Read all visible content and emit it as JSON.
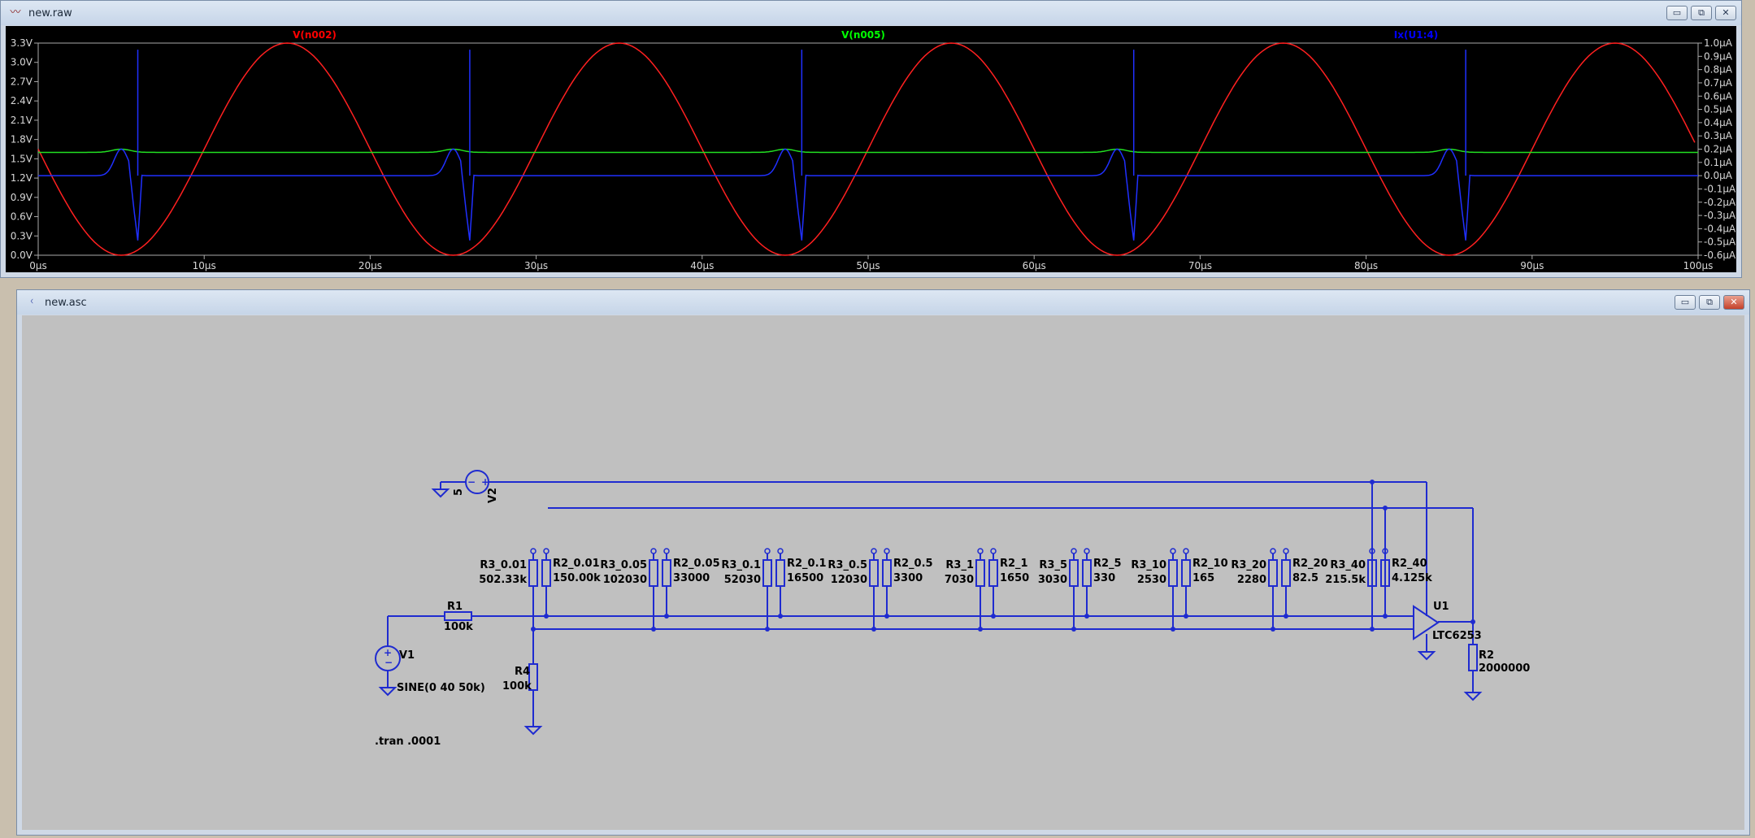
{
  "waveform_window": {
    "title": "new.raw",
    "minimize_label": "▭",
    "restore_label": "⧉",
    "close_label": "✕",
    "traces": [
      {
        "label": "V(n002)",
        "color": "#ff0000"
      },
      {
        "label": "V(n005)",
        "color": "#00ff00"
      },
      {
        "label": "Ix(U1:4)",
        "color": "#0000ff"
      }
    ],
    "left_ticks": [
      "3.3V",
      "3.0V",
      "2.7V",
      "2.4V",
      "2.1V",
      "1.8V",
      "1.5V",
      "1.2V",
      "0.9V",
      "0.6V",
      "0.3V",
      "0.0V"
    ],
    "right_ticks": [
      "1.0µA",
      "0.9µA",
      "0.8µA",
      "0.7µA",
      "0.6µA",
      "0.5µA",
      "0.4µA",
      "0.3µA",
      "0.2µA",
      "0.1µA",
      "0.0µA",
      "-0.1µA",
      "-0.2µA",
      "-0.3µA",
      "-0.4µA",
      "-0.5µA",
      "-0.6µA"
    ],
    "x_ticks": [
      "0µs",
      "10µs",
      "20µs",
      "30µs",
      "40µs",
      "50µs",
      "60µs",
      "70µs",
      "80µs",
      "90µs",
      "100µs"
    ]
  },
  "chart_data": {
    "type": "line",
    "xlabel": "",
    "x_unit": "µs",
    "xlim": [
      0,
      100
    ],
    "ylim_left": [
      0.0,
      3.3
    ],
    "ylim_right": [
      -0.6,
      1.0
    ],
    "grid": false,
    "legend_placement": "top",
    "series": [
      {
        "name": "V(n002)",
        "axis": "left",
        "shape": "sine",
        "period_us": 20,
        "min": 0.0,
        "max": 3.3,
        "peaks_us": [
          15,
          35,
          55,
          75,
          95
        ],
        "troughs_us": [
          5,
          25,
          45,
          65,
          85
        ],
        "values_at_x0": 1.6
      },
      {
        "name": "V(n005)",
        "axis": "left",
        "baseline": 1.6,
        "bump_peak": 1.65,
        "bump_times_us": [
          5,
          25,
          45,
          65,
          85
        ]
      },
      {
        "name": "Ix(U1:4)",
        "axis": "right",
        "baseline": 0.0,
        "spike_up_times_us": [
          6,
          26,
          46,
          66,
          86
        ],
        "spike_up": 0.95,
        "spike_down_times_us": [
          6,
          26,
          46,
          66,
          86
        ],
        "spike_down": -0.5,
        "bump_times_us": [
          5,
          25,
          45,
          65,
          85
        ],
        "bump_peak": 0.2
      }
    ]
  },
  "schematic_window": {
    "title": "new.asc",
    "minimize_label": "▭",
    "restore_label": "⧉",
    "close_label": "✕",
    "directive": ".tran .0001",
    "V1": {
      "name": "V1",
      "value": "SINE(0 40 50k)"
    },
    "V2": {
      "name": "V2",
      "value": "5"
    },
    "R1": {
      "name": "R1",
      "value": "100k"
    },
    "R4": {
      "name": "R4",
      "value": "100k"
    },
    "R2": {
      "name": "R2",
      "value": "2000000"
    },
    "U1": {
      "name": "U1",
      "value": "LTC6253"
    },
    "pairs": [
      {
        "r3": "R3_0.01",
        "r3v": "502.33k",
        "r2": "R2_0.01",
        "r2v": "150.00k"
      },
      {
        "r3": "R3_0.05",
        "r3v": "102030",
        "r2": "R2_0.05",
        "r2v": "33000"
      },
      {
        "r3": "R3_0.1",
        "r3v": "52030",
        "r2": "R2_0.1",
        "r2v": "16500"
      },
      {
        "r3": "R3_0.5",
        "r3v": "12030",
        "r2": "R2_0.5",
        "r2v": "3300"
      },
      {
        "r3": "R3_1",
        "r3v": "7030",
        "r2": "R2_1",
        "r2v": "1650"
      },
      {
        "r3": "R3_5",
        "r3v": "3030",
        "r2": "R2_5",
        "r2v": "330"
      },
      {
        "r3": "R3_10",
        "r3v": "2530",
        "r2": "R2_10",
        "r2v": "165"
      },
      {
        "r3": "R3_20",
        "r3v": "2280",
        "r2": "R2_20",
        "r2v": "82.5"
      },
      {
        "r3": "R3_40",
        "r3v": "215.5k",
        "r2": "R2_40",
        "r2v": "4.125k"
      }
    ]
  }
}
